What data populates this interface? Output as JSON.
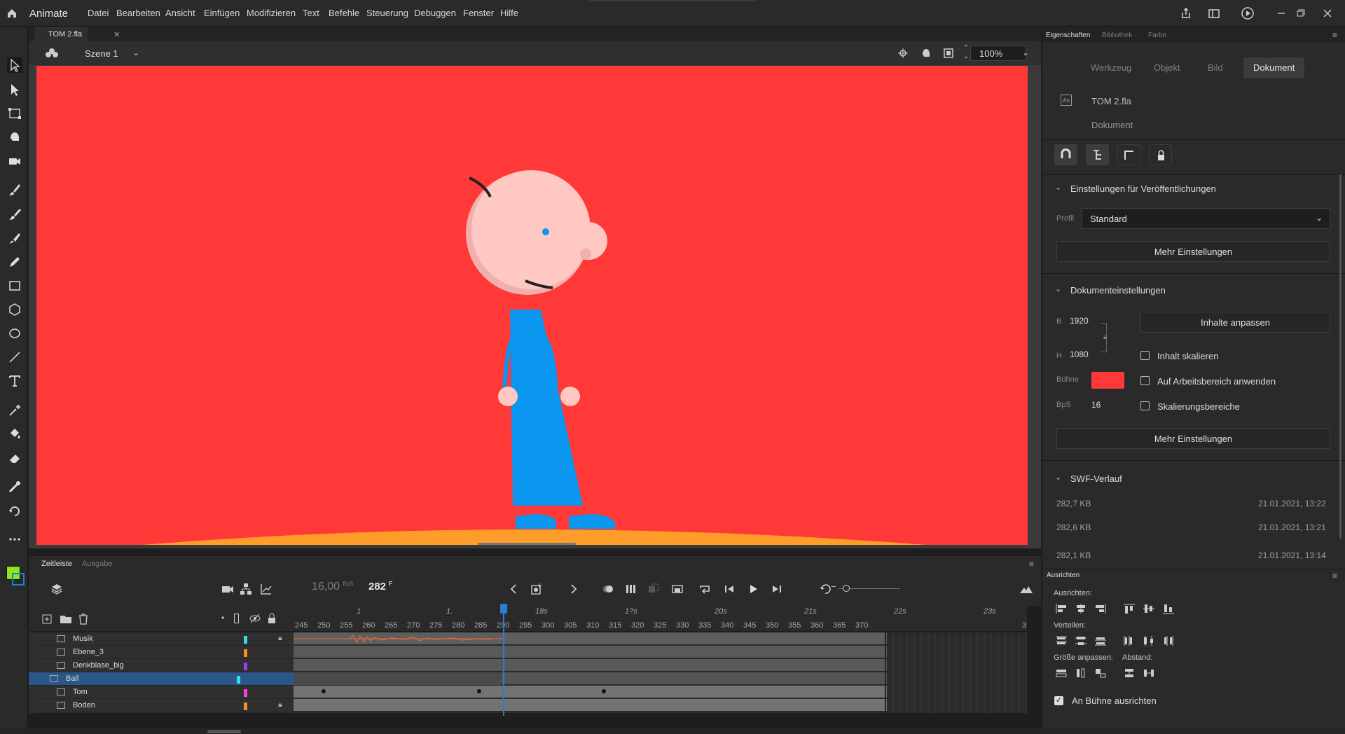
{
  "app": {
    "name": "Animate",
    "menu": [
      "Datei",
      "Bearbeiten",
      "Ansicht",
      "Einfügen",
      "Modifizieren",
      "Text",
      "Befehle",
      "Steuerung",
      "Debuggen",
      "Fenster",
      "Hilfe"
    ]
  },
  "document": {
    "tab_title": "TOM 2.fla",
    "scene": "Szene 1",
    "zoom": "100%"
  },
  "timeline": {
    "tab_active": "Zeitleiste",
    "tab_output": "Ausgabe",
    "fps": "16,00",
    "fps_unit": "BpS",
    "current_frame": "282",
    "frame_unit": "F",
    "ruler_numbers": [
      "245",
      "250",
      "255",
      "260",
      "265",
      "270",
      "275",
      "280",
      "285",
      "290",
      "295",
      "300",
      "305",
      "310",
      "315",
      "320",
      "325",
      "330",
      "335",
      "340",
      "345",
      "350",
      "355",
      "360",
      "365",
      "370",
      "3"
    ],
    "ruler_seconds": [
      "1",
      "1.",
      "18s",
      "1?s",
      "20s",
      "21s",
      "22s",
      "23s"
    ],
    "layers": [
      {
        "name": "Musik",
        "color": "#2fe0e6",
        "locked": true
      },
      {
        "name": "Ebene_3",
        "color": "#ff8c1a",
        "locked": false
      },
      {
        "name": "Denkblase_big",
        "color": "#9b3cf0",
        "locked": false
      },
      {
        "name": "Ball",
        "color": "#2fe0e6",
        "locked": false,
        "selected": true
      },
      {
        "name": "Tom",
        "color": "#ff3bd8",
        "locked": false
      },
      {
        "name": "Boden",
        "color": "#ff8c1a",
        "locked": true
      }
    ]
  },
  "properties": {
    "tabs": [
      "Eigenschaften",
      "Bibliothek",
      "Farbe"
    ],
    "segments": [
      "Werkzeug",
      "Objekt",
      "Bild",
      "Dokument"
    ],
    "active_segment": "Dokument",
    "file_name": "TOM 2.fla",
    "file_type": "Dokument",
    "publish_section": "Einstellungen für Veröffentlichungen",
    "profile_label": "Profil",
    "profile_value": "Standard",
    "more_settings": "Mehr Einstellungen",
    "doc_section": "Dokumenteinstellungen",
    "width_label": "B",
    "width_value": "1920",
    "height_label": "H",
    "height_value": "1080",
    "fit_content": "Inhalte anpassen",
    "scale_content": "Inhalt skalieren",
    "apply_workspace": "Auf Arbeitsbereich anwenden",
    "scale_ranges": "Skalierungsbereiche",
    "stage_label": "Bühne",
    "stage_color": "#ff3838",
    "fps_label": "BpS",
    "fps_value": "16",
    "swf_section": "SWF-Verlauf",
    "swf_history": [
      {
        "size": "282,7 KB",
        "date": "21.01.2021, 13:22"
      },
      {
        "size": "282,6 KB",
        "date": "21.01.2021, 13:21"
      },
      {
        "size": "282,1 KB",
        "date": "21.01.2021, 13:14"
      }
    ]
  },
  "align": {
    "title": "Ausrichten",
    "align_label": "Ausrichten:",
    "distribute_label": "Verteilen:",
    "size_label": "Größe anpassen:",
    "spacing_label": "Abstand:",
    "to_stage": "An Bühne ausrichten"
  },
  "colors": {
    "stage": "#ff3838",
    "character_blue": "#0b96f0",
    "skin": "#ffc8c3",
    "ground": "#ff9d2a",
    "fill_swatch": "#8de81a"
  }
}
